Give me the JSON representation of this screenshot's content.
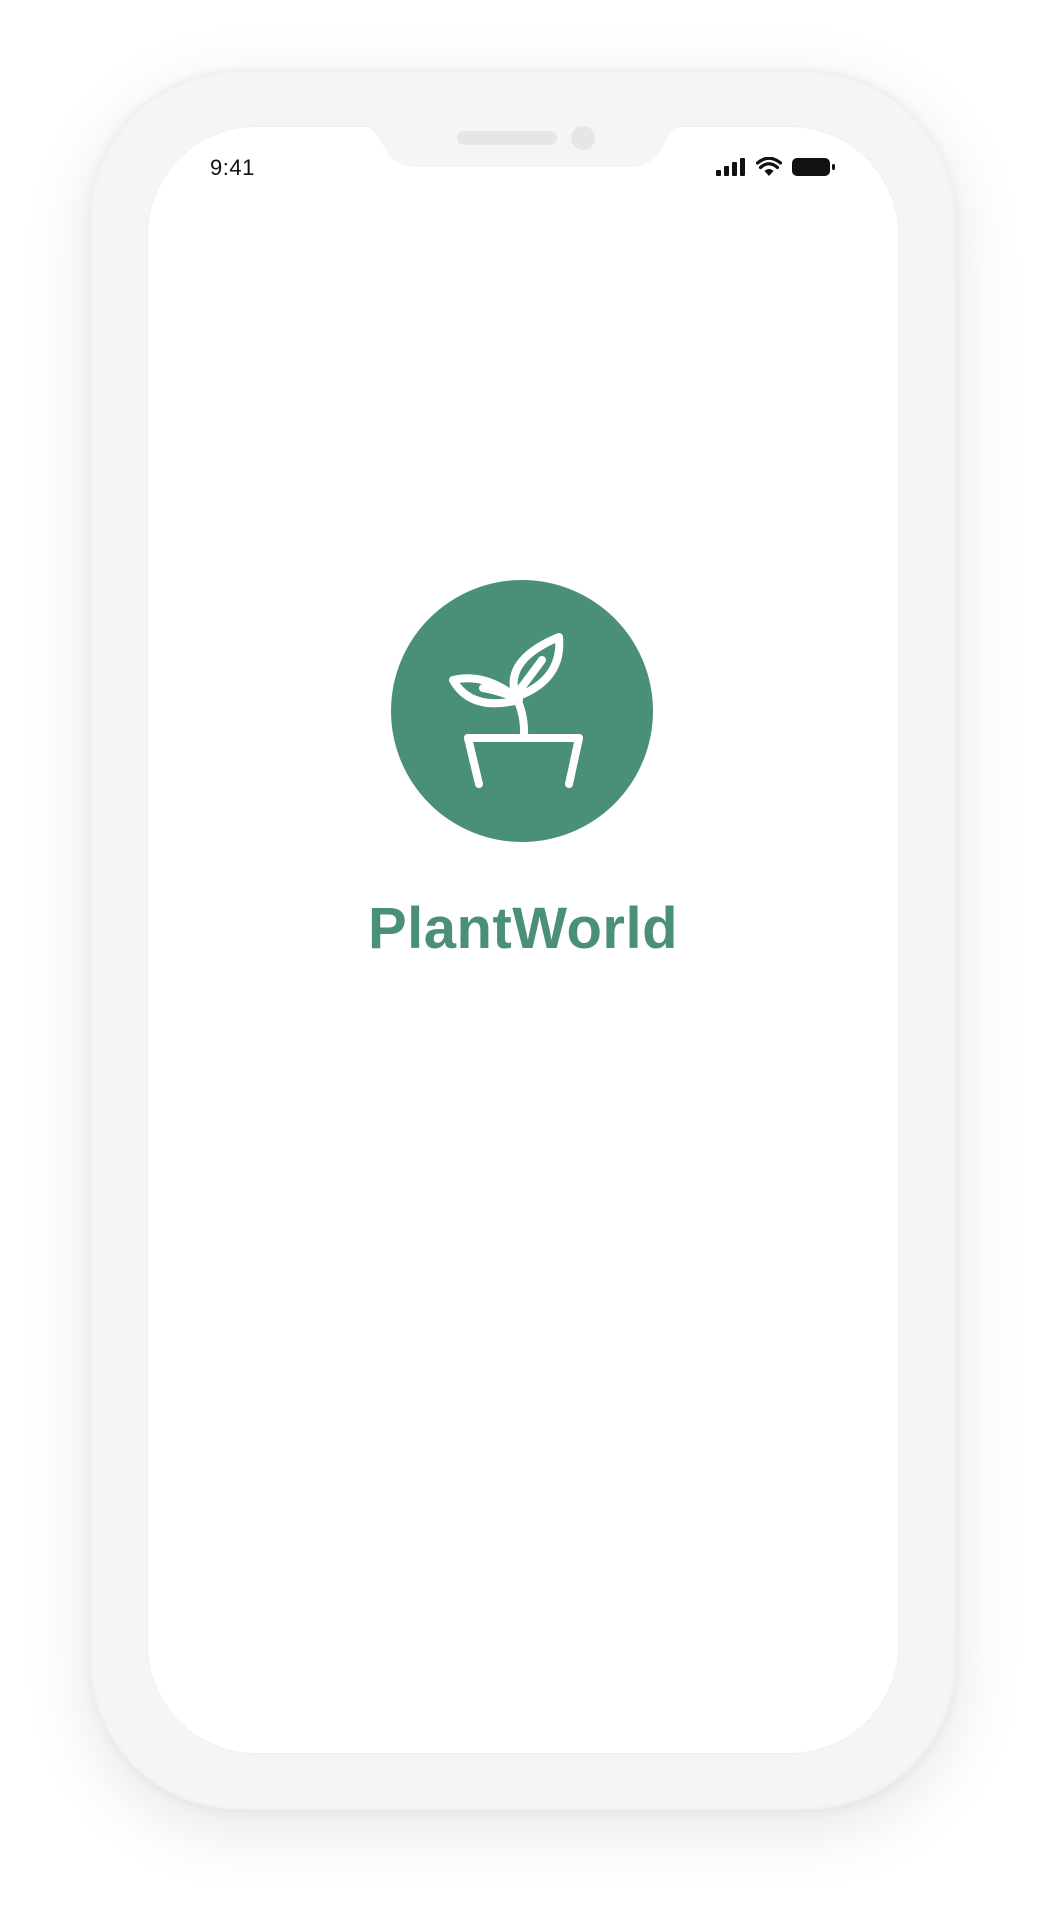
{
  "status_bar": {
    "time": "9:41",
    "icons": [
      "cellular-signal-icon",
      "wifi-icon",
      "battery-icon"
    ]
  },
  "splash": {
    "logo_icon": "potted-plant-icon",
    "app_name": "PlantWorld"
  },
  "colors": {
    "brand": "#4a9076",
    "background": "#ffffff",
    "device_frame": "#f5f5f5"
  }
}
